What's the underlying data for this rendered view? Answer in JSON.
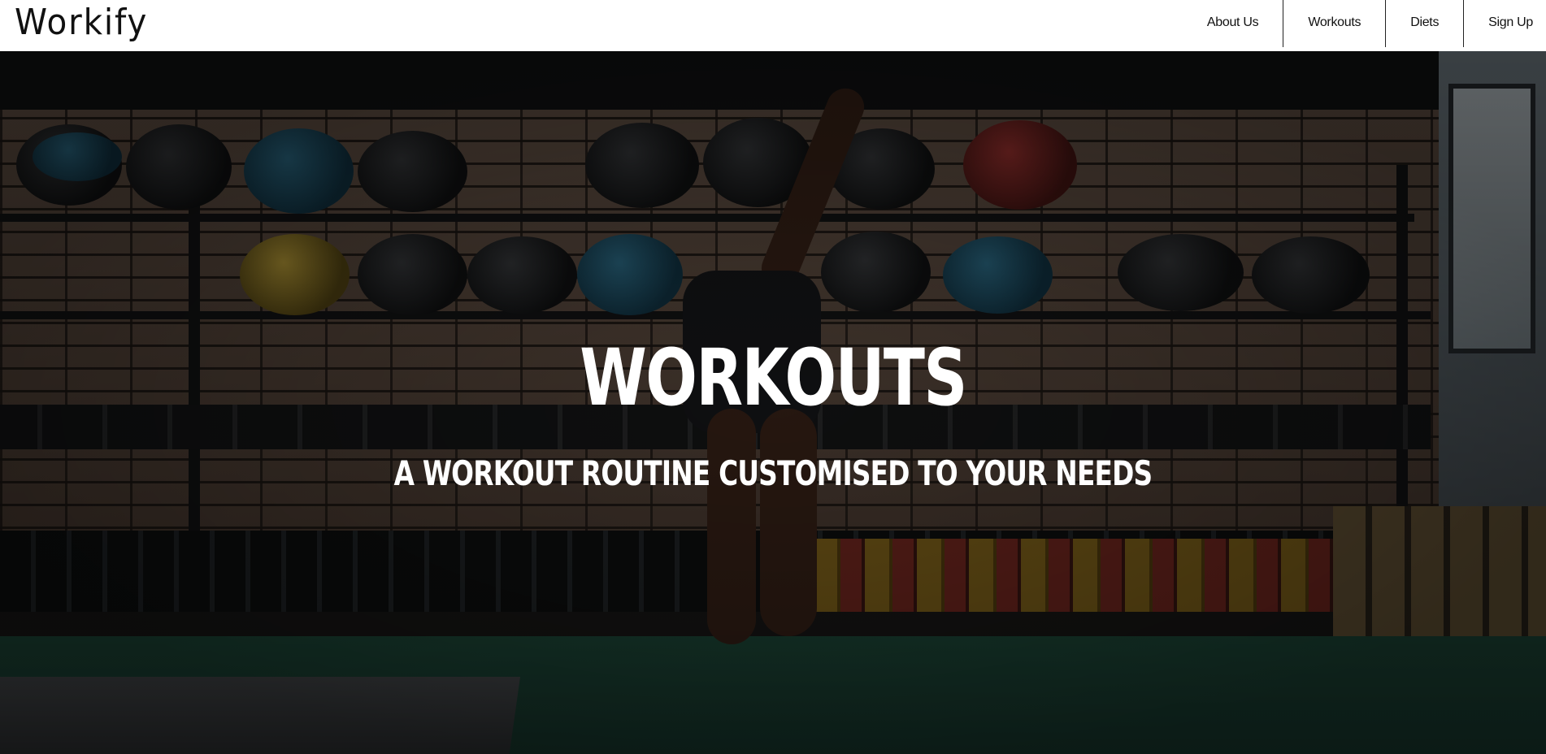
{
  "header": {
    "logo": "Workify",
    "nav": [
      {
        "label": "About Us"
      },
      {
        "label": "Workouts"
      },
      {
        "label": "Diets"
      },
      {
        "label": "Sign Up"
      }
    ]
  },
  "hero": {
    "title": "WORKOUTS",
    "subtitle": "A WORKOUT ROUTINE CUSTOMISED TO YOUR NEEDS"
  }
}
